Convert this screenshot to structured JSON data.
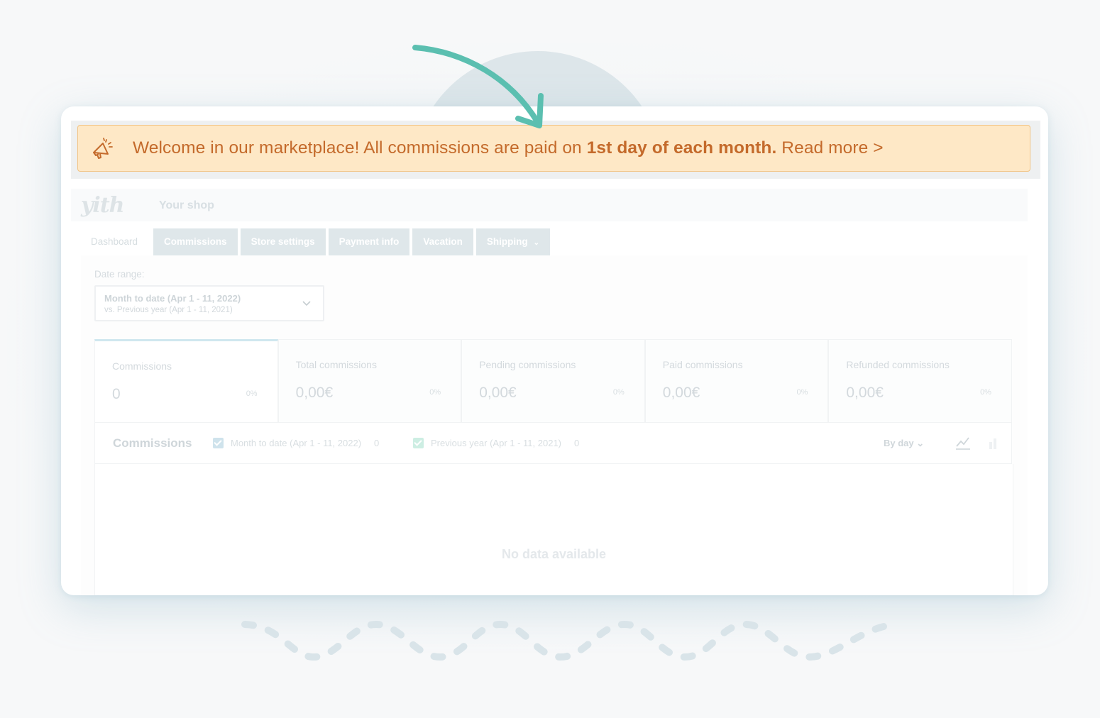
{
  "notice": {
    "text_prefix": "Welcome in our marketplace! All commissions are paid on ",
    "text_bold": "1st day of each month.",
    "read_more": "Read more >"
  },
  "header": {
    "logo": "yith",
    "shop_name": "Your shop"
  },
  "tabs": [
    {
      "label": "Dashboard",
      "active": true
    },
    {
      "label": "Commissions"
    },
    {
      "label": "Store settings"
    },
    {
      "label": "Payment info"
    },
    {
      "label": "Vacation"
    },
    {
      "label": "Shipping"
    }
  ],
  "date_range": {
    "label": "Date range:",
    "primary": "Month to date (Apr 1 - 11, 2022)",
    "secondary": "vs. Previous year (Apr 1 - 11, 2021)"
  },
  "stats": [
    {
      "label": "Commissions",
      "value": "0",
      "pct": "0%"
    },
    {
      "label": "Total commissions",
      "value": "0,00€",
      "pct": "0%"
    },
    {
      "label": "Pending commissions",
      "value": "0,00€",
      "pct": "0%"
    },
    {
      "label": "Paid commissions",
      "value": "0,00€",
      "pct": "0%"
    },
    {
      "label": "Refunded commissions",
      "value": "0,00€",
      "pct": "0%"
    }
  ],
  "chart": {
    "title": "Commissions",
    "legend": [
      {
        "label": "Month to date (Apr 1 - 11, 2022)",
        "count": "0",
        "color": "#cfe3ec"
      },
      {
        "label": "Previous year (Apr 1 - 11, 2021)",
        "count": "0",
        "color": "#cdeee3"
      }
    ],
    "interval": "By day",
    "empty_message": "No data available"
  },
  "colors": {
    "notice_bg": "#fee8c6",
    "notice_text": "#c46a2b",
    "arrow": "#5bbfb0"
  },
  "icons": [
    "megaphone-icon",
    "chevron-down-icon",
    "line-chart-icon",
    "bar-chart-icon",
    "arrow-pointer"
  ]
}
